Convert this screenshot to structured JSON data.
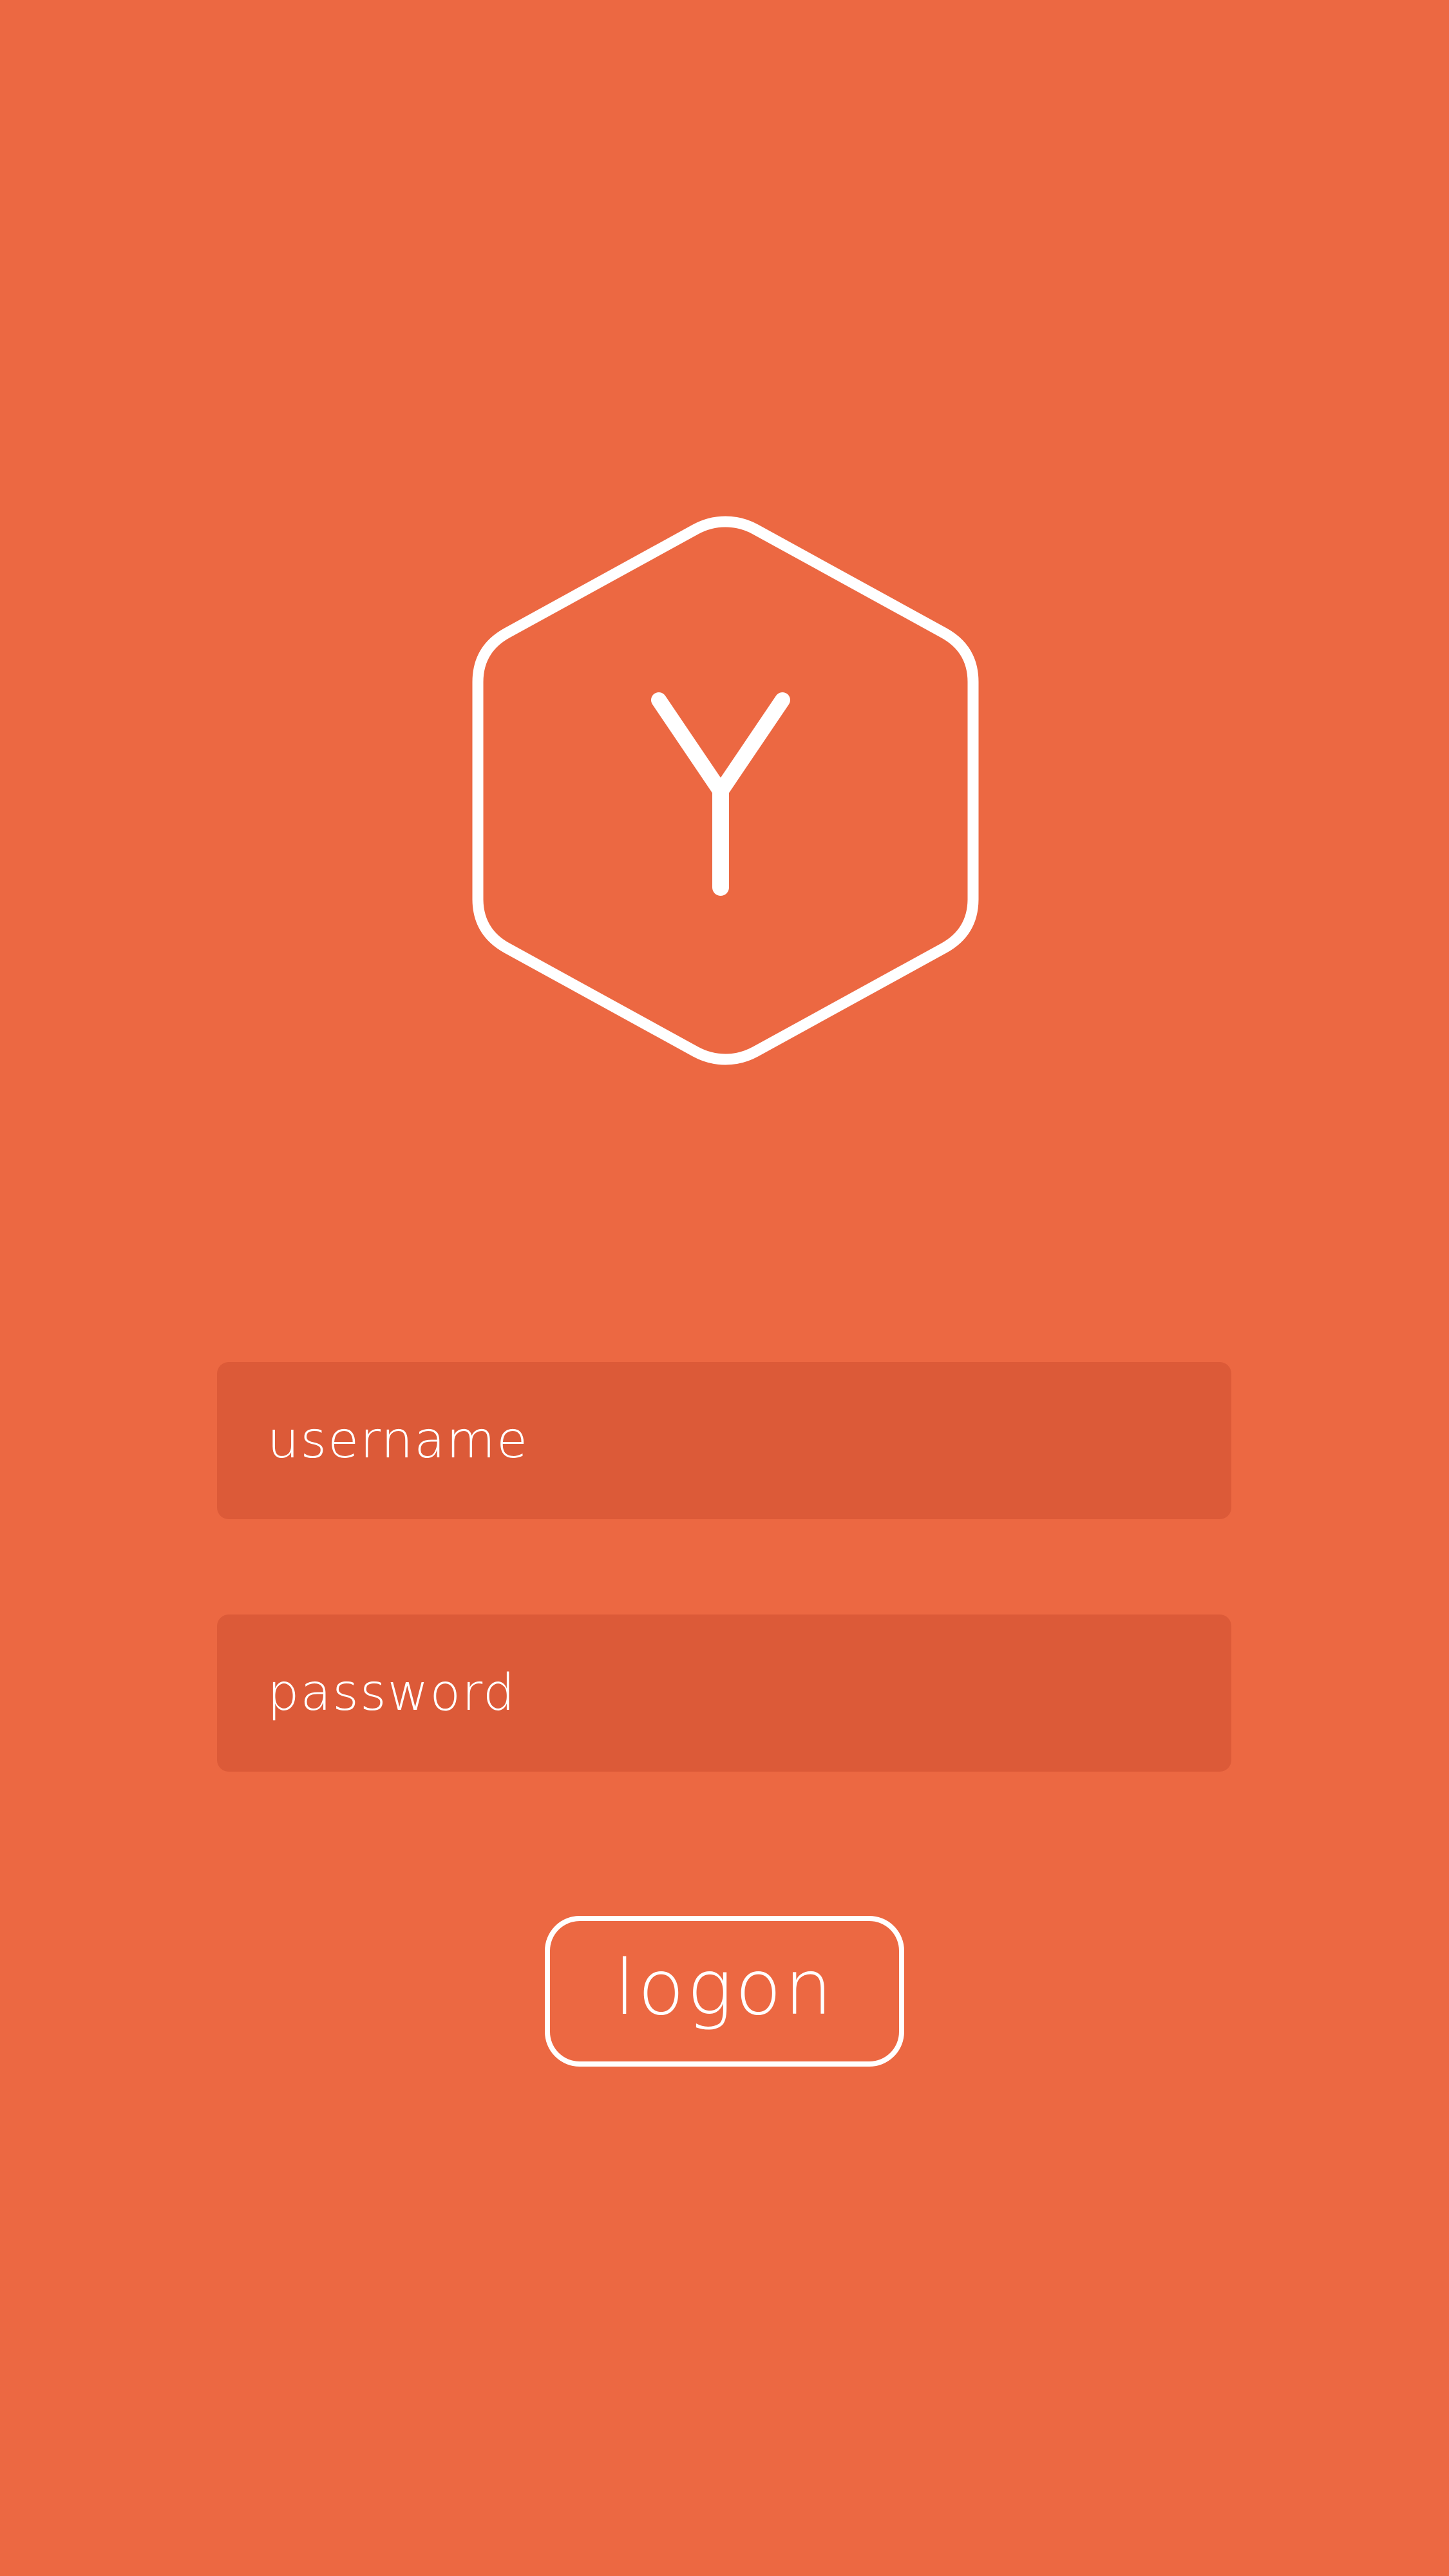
{
  "screen": {
    "background_color": "#EC6842",
    "field_color": "#DC5A38",
    "foreground_color": "#FFFFFF"
  },
  "logo": {
    "icon": "hexagon-y-logo-icon"
  },
  "login_form": {
    "username": {
      "value": "",
      "placeholder": "username"
    },
    "password": {
      "value": "",
      "placeholder": "password"
    },
    "logon_label": "logon"
  }
}
